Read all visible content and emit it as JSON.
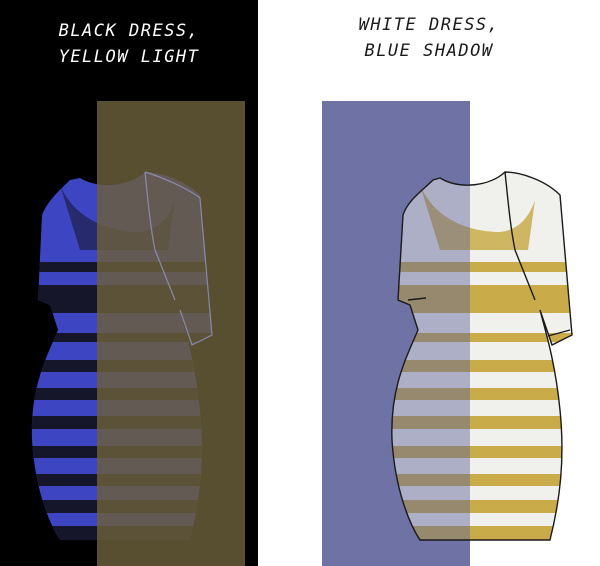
{
  "left_panel": {
    "caption": "Black dress,\nyellow light",
    "background": "#000000",
    "dress_color": "#3d45c2",
    "stripe_color": "#15162a",
    "overlay_color": "#6b5f3a"
  },
  "right_panel": {
    "caption": "White dress,\nblue shadow",
    "background": "#ffffff",
    "dress_color": "#f0f0ec",
    "stripe_color": "#c9ab4a",
    "overlay_color": "#7e82ad"
  }
}
